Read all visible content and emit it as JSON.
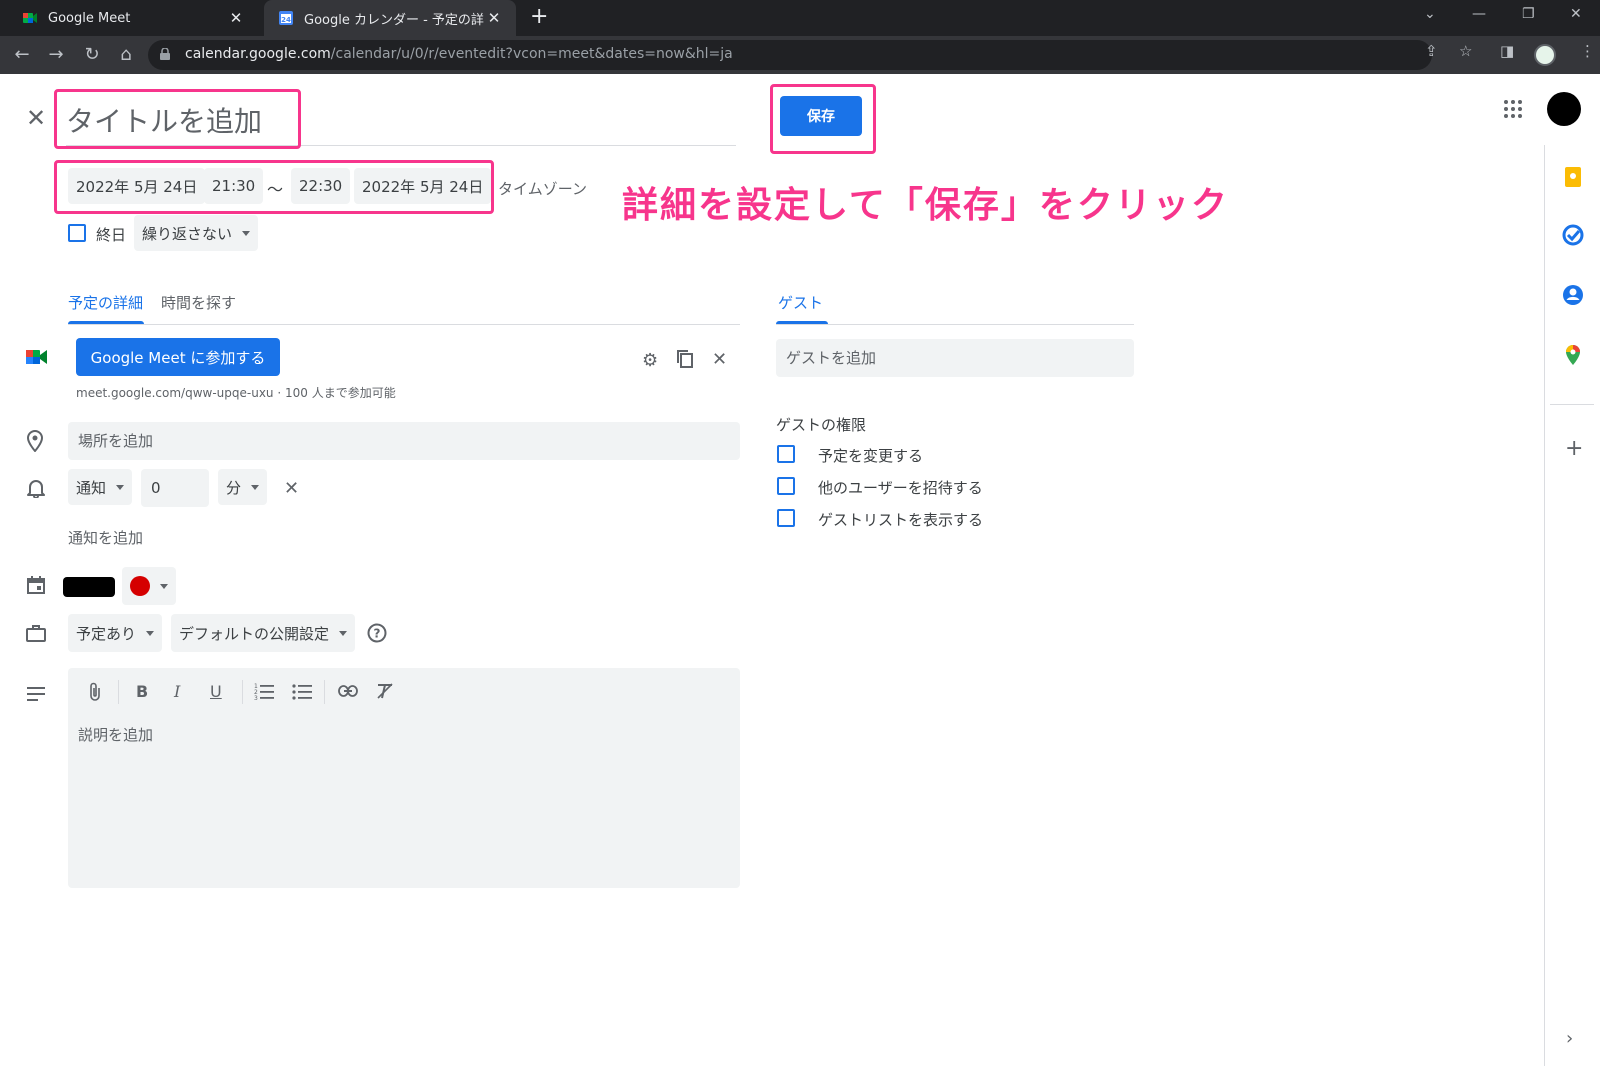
{
  "browser": {
    "tabs": [
      {
        "title": "Google Meet",
        "active": false
      },
      {
        "title": "Google カレンダー - 予定の詳細",
        "active": true
      }
    ],
    "url_host": "calendar.google.com",
    "url_path": "/calendar/u/0/r/eventedit?vcon=meet&dates=now&hl=ja",
    "window_controls": {
      "minimize": "—",
      "restore": "❐",
      "close": "✕",
      "dropdown": "⌄"
    }
  },
  "event": {
    "title_placeholder": "タイトルを追加",
    "save_label": "保存",
    "start_date": "2022年 5月 24日",
    "start_time": "21:30",
    "separator": "〜",
    "end_time": "22:30",
    "end_date": "2022年 5月 24日",
    "timezone_label": "タイムゾーン",
    "allday_label": "終日",
    "repeat_label": "繰り返さない"
  },
  "tabs": {
    "details": "予定の詳細",
    "find_time": "時間を探す",
    "guests": "ゲスト"
  },
  "meet": {
    "join_label": "Google Meet に参加する",
    "link_info": "meet.google.com/qww-upqe-uxu · 100 人まで参加可能"
  },
  "location": {
    "placeholder": "場所を追加"
  },
  "notification": {
    "type": "通知",
    "value": "0",
    "unit": "分",
    "add_label": "通知を追加"
  },
  "calendar": {
    "color": "#d50000"
  },
  "visibility": {
    "availability": "予定あり",
    "privacy": "デフォルトの公開設定"
  },
  "description": {
    "placeholder": "説明を追加"
  },
  "guests": {
    "add_placeholder": "ゲストを追加",
    "permissions_title": "ゲストの権限",
    "permissions": [
      "予定を変更する",
      "他のユーザーを招待する",
      "ゲストリストを表示する"
    ]
  },
  "annotation": {
    "text": "詳細を設定して「保存」をクリック",
    "color": "#f7358c"
  },
  "colors": {
    "accent": "#1a73e8",
    "chip_bg": "#f1f3f4"
  }
}
